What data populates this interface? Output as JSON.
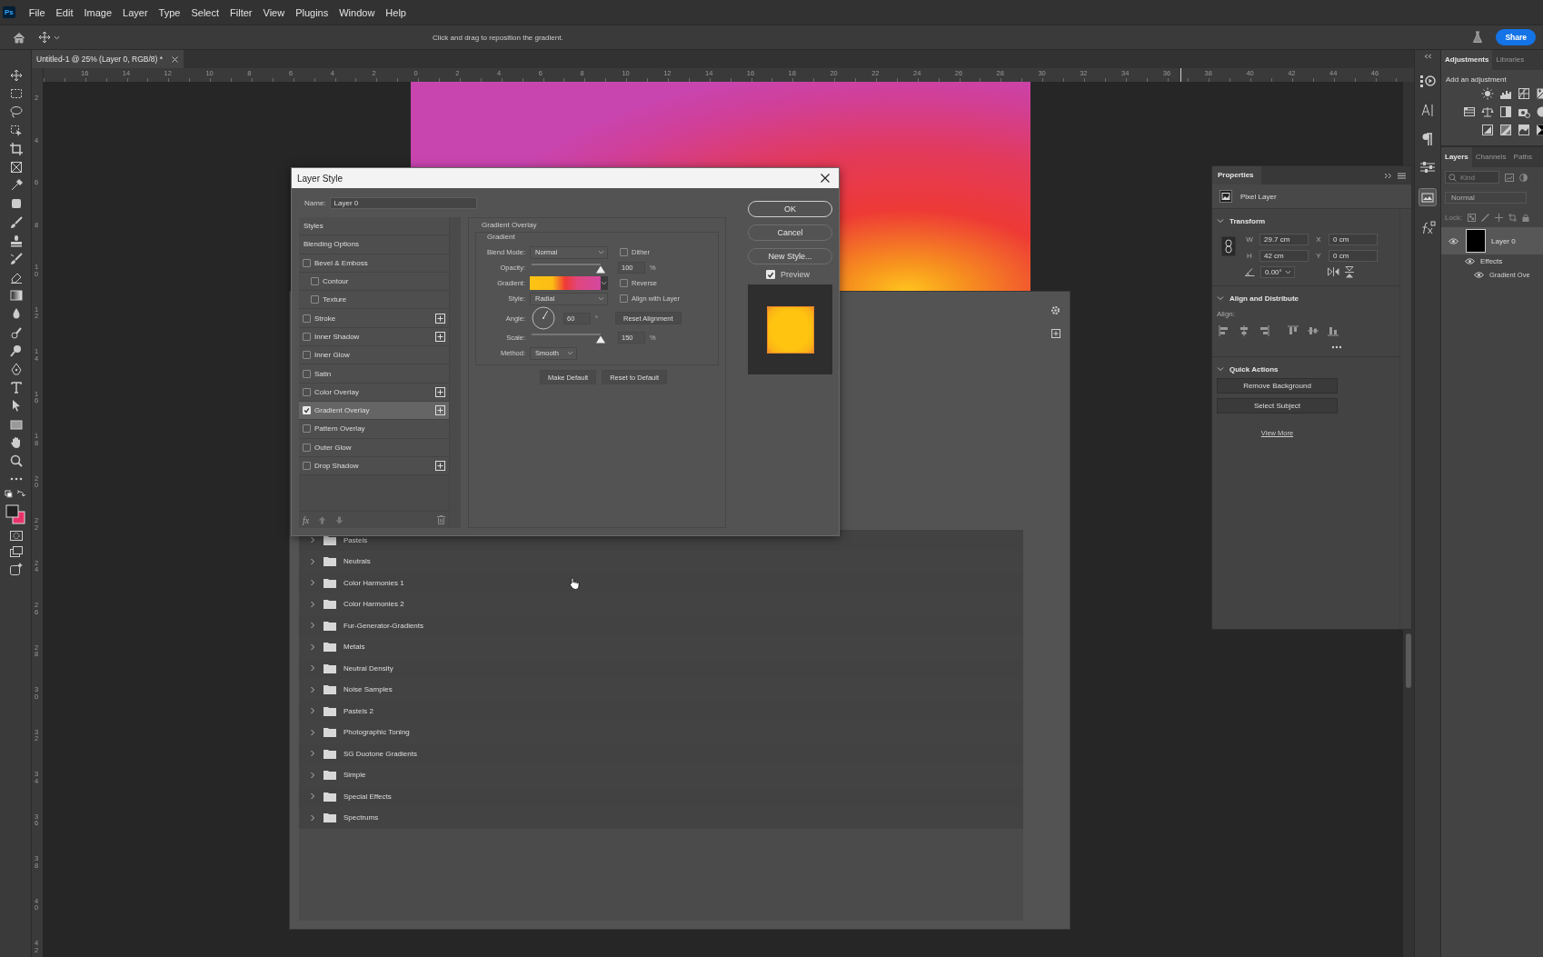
{
  "menu_bar": {
    "app_badge": "Ps",
    "items": [
      "File",
      "Edit",
      "Image",
      "Layer",
      "Type",
      "Select",
      "Filter",
      "View",
      "Plugins",
      "Window",
      "Help"
    ]
  },
  "options_bar": {
    "hint": "Click and drag to reposition the gradient.",
    "share_button": "Share"
  },
  "document_tabs": [
    {
      "label": "Untitled-1 @ 25% (Layer 0, RGB/8) *",
      "selected": true
    }
  ],
  "rulers": {
    "horizontal": [
      "16",
      "14",
      "12",
      "10",
      "8",
      "6",
      "4",
      "2",
      "0",
      "2",
      "4",
      "6",
      "8",
      "10",
      "12",
      "14",
      "16",
      "18",
      "20",
      "22",
      "24",
      "26",
      "28",
      "30",
      "32",
      "34",
      "36",
      "38",
      "40",
      "42",
      "44",
      "46"
    ],
    "vertical": [
      "2",
      "4",
      "6",
      "8",
      "10",
      "12",
      "14",
      "16",
      "18",
      "20",
      "22",
      "24",
      "26",
      "28",
      "30",
      "32",
      "34",
      "36",
      "38",
      "40",
      "42"
    ]
  },
  "gradient_presets": {
    "folders": [
      {
        "name": "Pastels",
        "expanded": false
      },
      {
        "name": "Neutrals",
        "expanded": false
      },
      {
        "name": "Color Harmonies 1",
        "expanded": false
      },
      {
        "name": "Color Harmonies 2",
        "expanded": false
      },
      {
        "name": "Fur-Generator-Gradients",
        "expanded": false
      },
      {
        "name": "Metals",
        "expanded": false
      },
      {
        "name": "Neutral Density",
        "expanded": false
      },
      {
        "name": "Noise Samples",
        "expanded": false
      },
      {
        "name": "Pastels 2",
        "expanded": false
      },
      {
        "name": "Photographic Toning",
        "expanded": false
      },
      {
        "name": "SG Duotone Gradients",
        "expanded": false
      },
      {
        "name": "Simple",
        "expanded": false
      },
      {
        "name": "Special Effects",
        "expanded": false
      },
      {
        "name": "Spectrums",
        "expanded": false
      }
    ]
  },
  "layer_style_dialog": {
    "title": "Layer Style",
    "name_label": "Name:",
    "name_value": "Layer 0",
    "style_headers": [
      "Styles",
      "Blending Options"
    ],
    "effects": [
      {
        "label": "Bevel & Emboss",
        "checked": false,
        "selected": false,
        "addable": false,
        "children": [
          {
            "label": "Contour",
            "checked": false,
            "selected": false,
            "addable": false
          },
          {
            "label": "Texture",
            "checked": false,
            "selected": false,
            "addable": false
          }
        ]
      },
      {
        "label": "Stroke",
        "checked": false,
        "selected": false,
        "addable": true
      },
      {
        "label": "Inner Shadow",
        "checked": false,
        "selected": false,
        "addable": true
      },
      {
        "label": "Inner Glow",
        "checked": false,
        "selected": false,
        "addable": false
      },
      {
        "label": "Satin",
        "checked": false,
        "selected": false,
        "addable": false
      },
      {
        "label": "Color Overlay",
        "checked": false,
        "selected": false,
        "addable": true
      },
      {
        "label": "Gradient Overlay",
        "checked": true,
        "selected": true,
        "addable": true
      },
      {
        "label": "Pattern Overlay",
        "checked": false,
        "selected": false,
        "addable": false
      },
      {
        "label": "Outer Glow",
        "checked": false,
        "selected": false,
        "addable": false
      },
      {
        "label": "Drop Shadow",
        "checked": false,
        "selected": false,
        "addable": true
      }
    ],
    "fx_button": "fx",
    "group_title": "Gradient Overlay",
    "subgroup_title": "Gradient",
    "blend_mode": {
      "label": "Blend Mode:",
      "value": "Normal"
    },
    "dither": {
      "label": "Dither",
      "checked": false
    },
    "opacity": {
      "label": "Opacity:",
      "level": 1,
      "value": "100",
      "unit": "%"
    },
    "gradient": {
      "label": "Gradient:"
    },
    "reverse": {
      "label": "Reverse",
      "checked": false
    },
    "style": {
      "label": "Style:",
      "value": "Radial"
    },
    "align_with_layer": {
      "label": "Align with Layer",
      "checked": false
    },
    "angle": {
      "label": "Angle:",
      "value": "60",
      "unit": "°"
    },
    "reset_alignment": "Reset Alignment",
    "scale": {
      "label": "Scale:",
      "level": 1,
      "value": "150",
      "unit": "%"
    },
    "method": {
      "label": "Method:",
      "value": "Smooth"
    },
    "buttons": [
      "Make Default",
      "Reset to Default"
    ],
    "side_buttons": [
      {
        "label": "OK",
        "default": true
      },
      {
        "label": "Cancel",
        "default": false
      },
      {
        "label": "New Style...",
        "default": false
      }
    ],
    "preview": {
      "label": "Preview",
      "checked": true
    }
  },
  "properties_panel": {
    "title": "Properties",
    "layer_kind": "Pixel Layer",
    "transform": {
      "title": "Transform",
      "expanded": true,
      "w_label": "W",
      "w": "29.7 cm",
      "x_label": "X",
      "x": "0 cm",
      "h_label": "H",
      "h": "42 cm",
      "y_label": "Y",
      "y": "0 cm",
      "angle": "0.00°"
    },
    "align": {
      "title": "Align and Distribute",
      "expanded": true,
      "label": "Align:"
    },
    "quick_actions": {
      "title": "Quick Actions",
      "expanded": true,
      "buttons": [
        "Remove Background",
        "Select Subject"
      ],
      "link": "View More"
    }
  },
  "adjustments_panel": {
    "tabs": [
      {
        "label": "Adjustments",
        "selected": true
      },
      {
        "label": "Libraries",
        "selected": false
      }
    ],
    "heading": "Add an adjustment"
  },
  "layers_panel": {
    "tabs": [
      {
        "label": "Layers",
        "selected": true
      },
      {
        "label": "Channels",
        "selected": false
      },
      {
        "label": "Paths",
        "selected": false
      }
    ],
    "filter_placeholder": "Kind",
    "blend_mode": "Normal",
    "lock_label": "Lock:",
    "layers": [
      {
        "name": "Layer 0",
        "visible": true,
        "selected": true,
        "kind": "layer",
        "children": [
          {
            "name": "Effects",
            "visible": true,
            "selected": false,
            "kind": "effects",
            "children": [
              {
                "name": "Gradient Ove",
                "visible": true,
                "selected": false,
                "kind": "effect"
              }
            ]
          }
        ]
      }
    ]
  }
}
